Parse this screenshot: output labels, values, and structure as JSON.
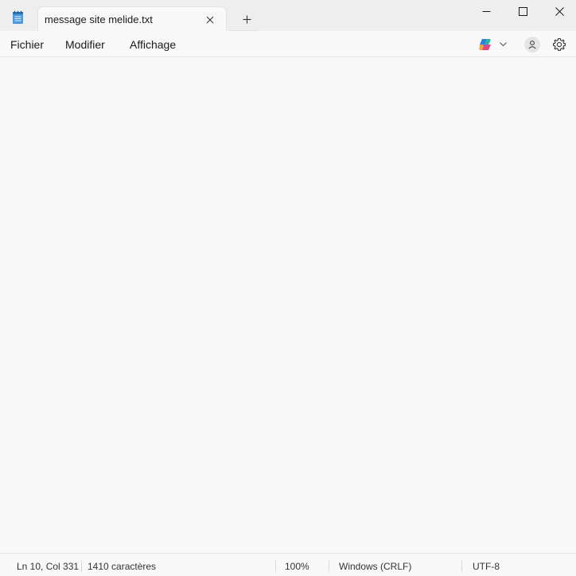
{
  "window": {
    "tab_title": "message site melide.txt",
    "icons": {
      "app": "notepad-icon",
      "tab_close": "close-icon",
      "new_tab": "plus-icon",
      "minimize": "minimize-icon",
      "maximize": "maximize-icon",
      "close": "close-icon"
    }
  },
  "menu": {
    "items": [
      "Fichier",
      "Modifier",
      "Affichage"
    ],
    "icons": {
      "copilot": "copilot-icon",
      "copilot_dropdown": "chevron-down-icon",
      "account": "account-icon",
      "settings": "gear-icon"
    }
  },
  "editor": {
    "content": ""
  },
  "status": {
    "position": "Ln 10, Col 331",
    "characters": "1410 caractères",
    "zoom": "100%",
    "line_ending": "Windows (CRLF)",
    "encoding": "UTF-8"
  },
  "colors": {
    "titlebar": "#eeeeee",
    "surface": "#f9f9f9",
    "text": "#1a1a1a",
    "notepad_blue": "#3b8ad9"
  }
}
